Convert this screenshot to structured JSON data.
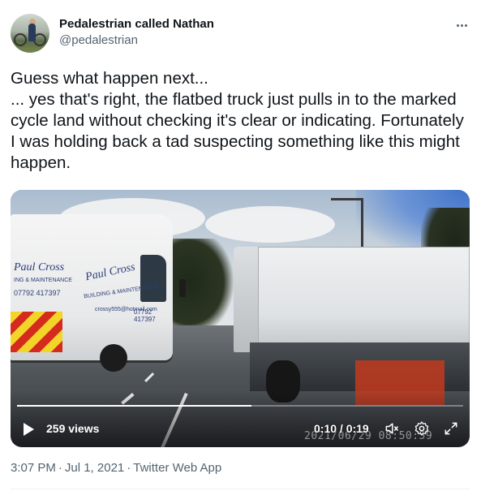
{
  "author": {
    "display_name": "Pedalestrian called Nathan",
    "handle": "@pedalestrian",
    "avatar_icon": "cyclist-avatar"
  },
  "more_icon": "more-horizontal-icon",
  "tweet": {
    "text": "Guess what happen next...\n... yes that's right, the flatbed truck just pulls in to the marked cycle land without checking it's clear or indicating. Fortunately I was holding back a tad suspecting something like this might happen."
  },
  "video": {
    "views": "259 views",
    "time": "0:10 / 0:19",
    "progress": 0.526,
    "dashcam_timestamp": "2021/06/29 08:50:59",
    "van_lettering": {
      "brand_left": "Paul Cross",
      "tagline_left": "ING & MAINTENANCE",
      "phone_left": "07792 417397",
      "brand_side": "Paul Cross",
      "tagline_side": "BUILDING & MAINTENANCE",
      "email_side": "crossy555@hotmail.com",
      "phone_side": "07792 417397"
    },
    "play_icon": "play-icon",
    "mute_icon": "volume-muted-icon",
    "settings_icon": "gear-icon",
    "fullscreen_icon": "fullscreen-icon"
  },
  "meta": {
    "time": "3:07 PM",
    "date": "Jul 1, 2021",
    "source": "Twitter Web App",
    "separator": "·"
  }
}
